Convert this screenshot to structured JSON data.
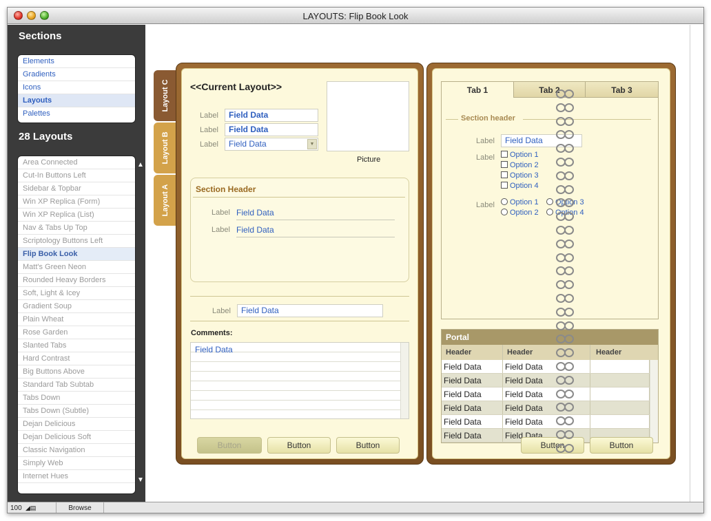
{
  "window": {
    "title": "LAYOUTS: Flip Book Look"
  },
  "sidebar": {
    "sections_heading": "Sections",
    "sections": [
      {
        "label": "Elements"
      },
      {
        "label": "Gradients"
      },
      {
        "label": "Icons"
      },
      {
        "label": "Layouts",
        "selected": true
      },
      {
        "label": "Palettes"
      }
    ],
    "layouts_heading": "28 Layouts",
    "layouts": [
      "Area Connected",
      "Cut-In Buttons Left",
      "Sidebar & Topbar",
      "Win XP Replica (Form)",
      "Win XP Replica (List)",
      "Nav & Tabs Up Top",
      "Scriptology Buttons Left",
      "Flip Book Look",
      "Matt's Green Neon",
      "Rounded Heavy Borders",
      "Soft, Light & Icey",
      "Gradient Soup",
      "Plain Wheat",
      "Rose Garden",
      "Slanted Tabs",
      "Hard Contrast",
      "Big Buttons Above",
      "Standard Tab Subtab",
      "Tabs Down",
      "Tabs Down (Subtle)",
      "Dejan Delicious",
      "Dejan Delicious Soft",
      "Classic Navigation",
      "Simply Web",
      "Internet Hues"
    ],
    "selected_layout": "Flip Book Look"
  },
  "side_tabs": [
    "Layout C",
    "Layout B",
    "Layout A"
  ],
  "left_page": {
    "title": "<<Current Layout>>",
    "fields": [
      {
        "label": "Label",
        "value": "Field Data"
      },
      {
        "label": "Label",
        "value": "Field Data"
      },
      {
        "label": "Label",
        "value": "Field Data"
      }
    ],
    "picture_label": "Picture",
    "section_header": "Section Header",
    "section_fields": [
      {
        "label": "Label",
        "value": "Field Data"
      },
      {
        "label": "Label",
        "value": "Field Data"
      }
    ],
    "bottom_field": {
      "label": "Label",
      "value": "Field Data"
    },
    "comments_label": "Comments:",
    "comments_value": "Field Data",
    "buttons": [
      "Button",
      "Button",
      "Button"
    ]
  },
  "right_page": {
    "tabs": [
      "Tab 1",
      "Tab 2",
      "Tab 3"
    ],
    "section_header": "Section header",
    "field": {
      "label": "Label",
      "value": "Field Data"
    },
    "checkbox_label": "Label",
    "checkboxes": [
      "Option 1",
      "Option 2",
      "Option 3",
      "Option 4"
    ],
    "radio_label": "Label",
    "radios": [
      "Option 1",
      "Option 3",
      "Option 2",
      "Option 4"
    ],
    "portal": {
      "title": "Portal",
      "headers": [
        "Header",
        "Header",
        "Header"
      ],
      "rows": [
        [
          "Field Data",
          "Field Data",
          ""
        ],
        [
          "Field Data",
          "Field Data",
          ""
        ],
        [
          "Field Data",
          "Field Data",
          ""
        ],
        [
          "Field Data",
          "Field Data",
          ""
        ],
        [
          "Field Data",
          "Field Data",
          ""
        ],
        [
          "Field Data",
          "Field Data",
          ""
        ]
      ]
    },
    "buttons": [
      "Button",
      "Button"
    ]
  },
  "status": {
    "zoom": "100",
    "mode": "Browse"
  },
  "colors": {
    "cover": "#8a5a28",
    "page": "#fdf9dc",
    "accent": "#2f5fbf",
    "tab_c": "#8a5a32",
    "tab_b": "#d3a24a"
  }
}
